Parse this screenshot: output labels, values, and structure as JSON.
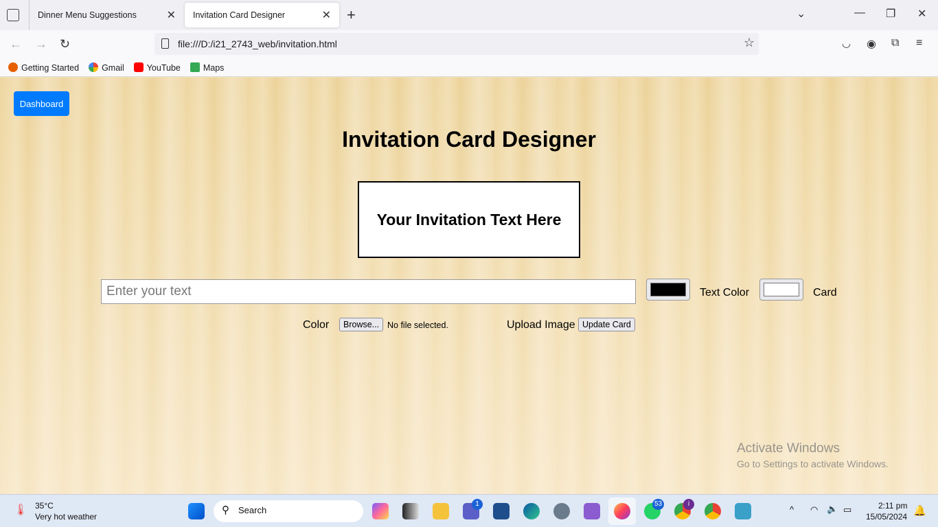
{
  "browser": {
    "tabs": [
      {
        "label": "Dinner Menu Suggestions",
        "active": false
      },
      {
        "label": "Invitation Card Designer",
        "active": true
      }
    ],
    "url": "file:///D:/i21_2743_web/invitation.html",
    "bookmarks": [
      {
        "label": "Getting Started",
        "icon": "firefox-icon"
      },
      {
        "label": "Gmail",
        "icon": "google-icon"
      },
      {
        "label": "YouTube",
        "icon": "youtube-icon"
      },
      {
        "label": "Maps",
        "icon": "maps-icon"
      }
    ]
  },
  "page": {
    "dashboard_label": "Dashboard",
    "title": "Invitation Card Designer",
    "card_text": "Your Invitation Text Here",
    "text_input": {
      "value": "",
      "placeholder": "Enter your text"
    },
    "text_color": "#000000",
    "text_color_label": "Text Color",
    "card_color": "#ffffff",
    "card_color_label_1": "Card",
    "card_color_label_2": "Color",
    "browse_label": "Browse...",
    "file_status": "No file selected.",
    "upload_label": "Upload Image",
    "update_label": "Update Card"
  },
  "watermark": {
    "title": "Activate Windows",
    "subtitle": "Go to Settings to activate Windows."
  },
  "taskbar": {
    "weather_temp": "35°C",
    "weather_desc": "Very hot weather",
    "search_label": "Search",
    "teams_badge": "1",
    "whatsapp_badge": "53",
    "chrome_badge": "i",
    "time": "2:11 pm",
    "date": "15/05/2024"
  }
}
